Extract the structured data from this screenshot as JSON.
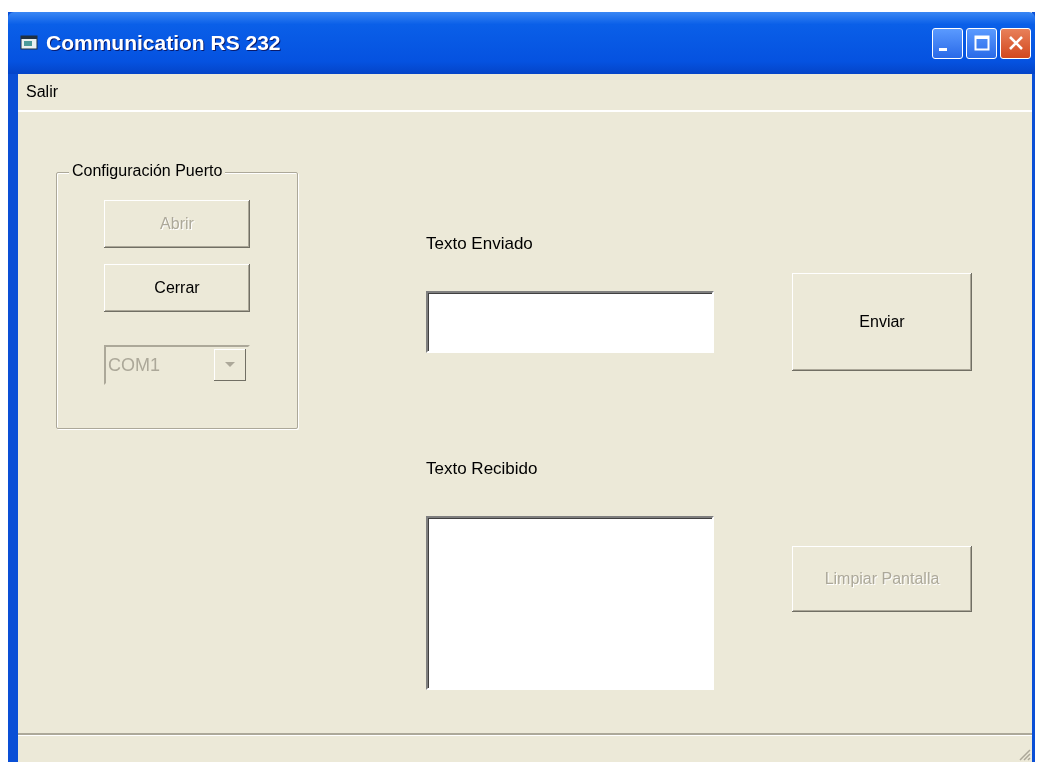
{
  "window": {
    "title": "Communication RS 232"
  },
  "menu": [
    {
      "label": "Salir"
    }
  ],
  "port_group": {
    "title": "Configuración Puerto",
    "buttons": [
      {
        "label": "Abrir",
        "disabled": true
      },
      {
        "label": "Cerrar",
        "disabled": false
      }
    ],
    "port_combo": {
      "value": "COM1",
      "disabled": true
    }
  },
  "sent": {
    "label": "Texto Enviado"
  },
  "send_button": {
    "label": "Enviar",
    "disabled": false
  },
  "received": {
    "label": "Texto Recibido"
  },
  "clear_button": {
    "label": "Limpiar Pantalla",
    "disabled": true
  }
}
